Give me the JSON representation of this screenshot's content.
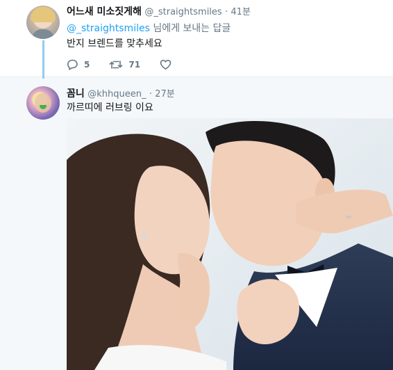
{
  "tweets": [
    {
      "display_name": "어느새 미소짓게해",
      "handle": "@_straightsmiles",
      "time": "· 41분",
      "reply_prefix": "@_straightsmiles",
      "reply_suffix": " 님에게 보내는 답글",
      "text": "반지 브렌드를 맞추세요",
      "actions": {
        "reply_count": "5",
        "retweet_count": "71",
        "like_count": ""
      }
    },
    {
      "display_name": "꼼니",
      "handle": "@khhqueen_",
      "time": "· 27분",
      "text": "까르띠에 러브링 이요"
    }
  ],
  "icons": {
    "reply": "reply-icon",
    "retweet": "retweet-icon",
    "like": "heart-icon"
  },
  "colors": {
    "link": "#1da1f2",
    "secondary": "#657786",
    "thread_line": "#8ecdf1",
    "highlight_bg": "#f5f8fa"
  }
}
